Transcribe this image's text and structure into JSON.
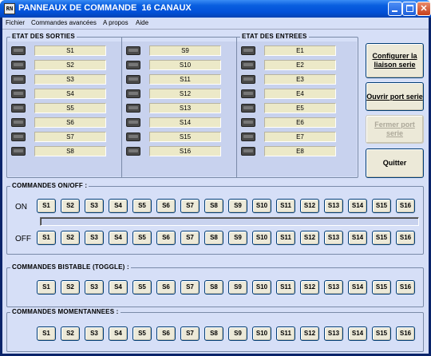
{
  "window": {
    "title": "PANNEAUX DE COMMANDE  16 CANAUX",
    "icon_text": "RN"
  },
  "menu": [
    "Fichier",
    "Commandes avancées",
    "A propos",
    "Aide"
  ],
  "etat_sorties": {
    "title": "ETAT DES SORTIES",
    "col1": [
      "S1",
      "S2",
      "S3",
      "S4",
      "S5",
      "S6",
      "S7",
      "S8"
    ],
    "col2": [
      "S9",
      "S10",
      "S11",
      "S12",
      "S13",
      "S14",
      "S15",
      "S16"
    ]
  },
  "etat_entrees": {
    "title": "ETAT DES ENTREES",
    "items": [
      "E1",
      "E2",
      "E3",
      "E4",
      "E5",
      "E6",
      "E7",
      "E8"
    ]
  },
  "side_buttons": {
    "configurer": "Configurer la liaison serie",
    "ouvrir": "Ouvrir port serie",
    "fermer": "Fermer port serie",
    "quitter": "Quitter"
  },
  "onoff": {
    "title": "COMMANDES ON/OFF :",
    "on_label": "ON",
    "off_label": "OFF",
    "progress": 0
  },
  "toggle": {
    "title": "COMMANDES BISTABLE (TOGGLE) :"
  },
  "momentary": {
    "title": "COMMANDES MOMENTANNEES :"
  },
  "channels": [
    "S1",
    "S2",
    "S3",
    "S4",
    "S5",
    "S6",
    "S7",
    "S8",
    "S9",
    "S10",
    "S11",
    "S12",
    "S13",
    "S14",
    "S15",
    "S16"
  ],
  "colors": {
    "title_bar": "#0a5fe0",
    "client_bg": "#d6dff7",
    "label_bg": "#ece9c8",
    "led_off": "#4a4a4a"
  }
}
